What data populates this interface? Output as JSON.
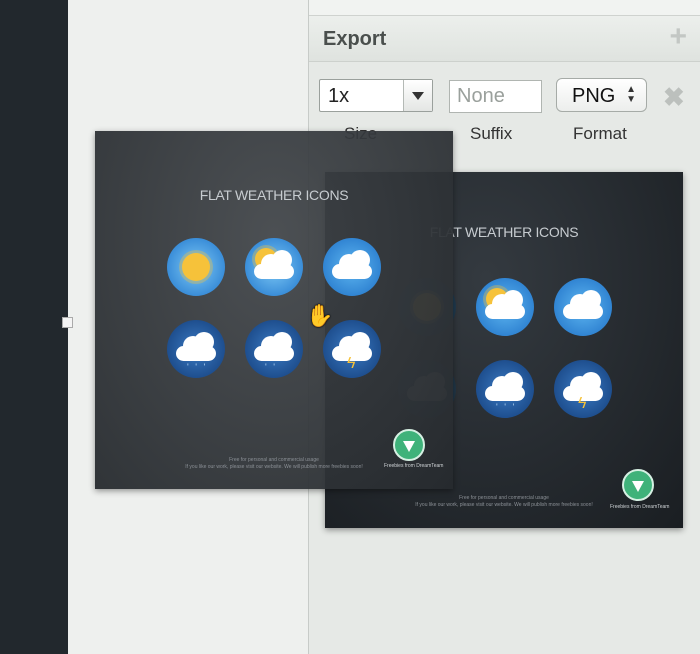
{
  "export": {
    "title": "Export",
    "add_icon": "plus-icon",
    "remove_icon": "close-icon",
    "size": {
      "value": "1x",
      "label": "Size"
    },
    "suffix": {
      "placeholder": "None",
      "label": "Suffix"
    },
    "format": {
      "value": "PNG",
      "label": "Format"
    }
  },
  "artboard": {
    "title": "FLAT WEATHER ICONS",
    "footer_line1": "Free for personal and commercial usage",
    "footer_line2": "If you like our work, please visit our website. We will publish more freebies soon!",
    "badge_text": "Freebies from DreamTeam"
  },
  "colors": {
    "accent_green": "#3fb27a",
    "sun_yellow": "#f6c23a",
    "icon_blue": "#2a88d8"
  }
}
